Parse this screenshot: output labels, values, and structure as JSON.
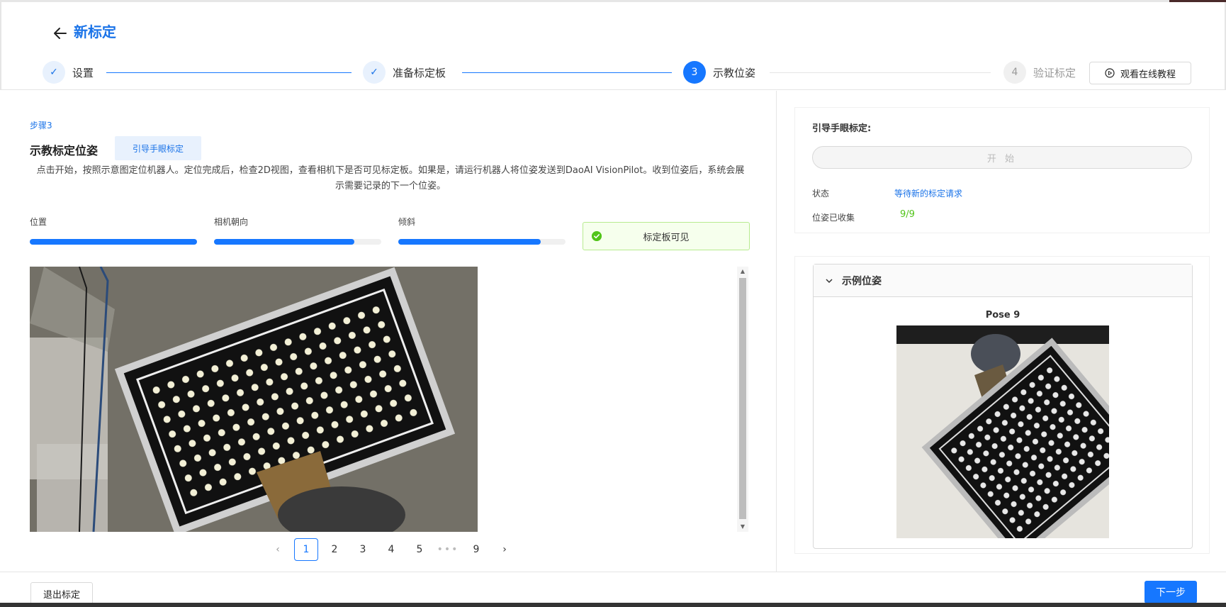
{
  "header": {
    "title": "新标定",
    "tutorial_label": "观看在线教程",
    "steps": [
      {
        "num": "1",
        "label": "设置",
        "state": "done"
      },
      {
        "num": "2",
        "label": "准备标定板",
        "state": "done"
      },
      {
        "num": "3",
        "label": "示教位姿",
        "state": "active"
      },
      {
        "num": "4",
        "label": "验证标定",
        "state": "todo"
      }
    ]
  },
  "left": {
    "step_no": "步骤3",
    "title": "示教标定位姿",
    "guide_tag": "引导手眼标定",
    "instructions": "点击开始，按照示意图定位机器人。定位完成后，检查2D视图，查看相机下是否可见标定板。如果是，请运行机器人将位姿发送到DaoAI VisionPilot。收到位姿后，系统会展示需要记录的下一个位姿。",
    "progress": [
      {
        "label": "位置",
        "value": 1.0
      },
      {
        "label": "相机朝向",
        "value": 0.84
      },
      {
        "label": "倾斜",
        "value": 0.85
      }
    ],
    "board_visible": "标定板可见",
    "pagination": {
      "pages": [
        "1",
        "2",
        "3",
        "4",
        "5",
        "•••",
        "9"
      ],
      "current": "1",
      "prev": "‹",
      "next": "›"
    }
  },
  "right": {
    "guide_title": "引导手眼标定:",
    "start_label": "开 始",
    "status_label": "状态",
    "status_value": "等待新的标定请求",
    "collected_label": "位姿已收集",
    "collected_value": "9/9",
    "sample_title": "示例位姿",
    "pose_label": "Pose 9"
  },
  "footer": {
    "exit_label": "退出标定",
    "next_label": "下一步"
  },
  "colors": {
    "accent": "#1677ff",
    "success": "#52c41a"
  },
  "icons": [
    "back-arrow-icon",
    "check-icon",
    "play-circle-icon",
    "chevron-down-icon",
    "check-circle-icon",
    "chevron-left-icon",
    "chevron-right-icon"
  ]
}
